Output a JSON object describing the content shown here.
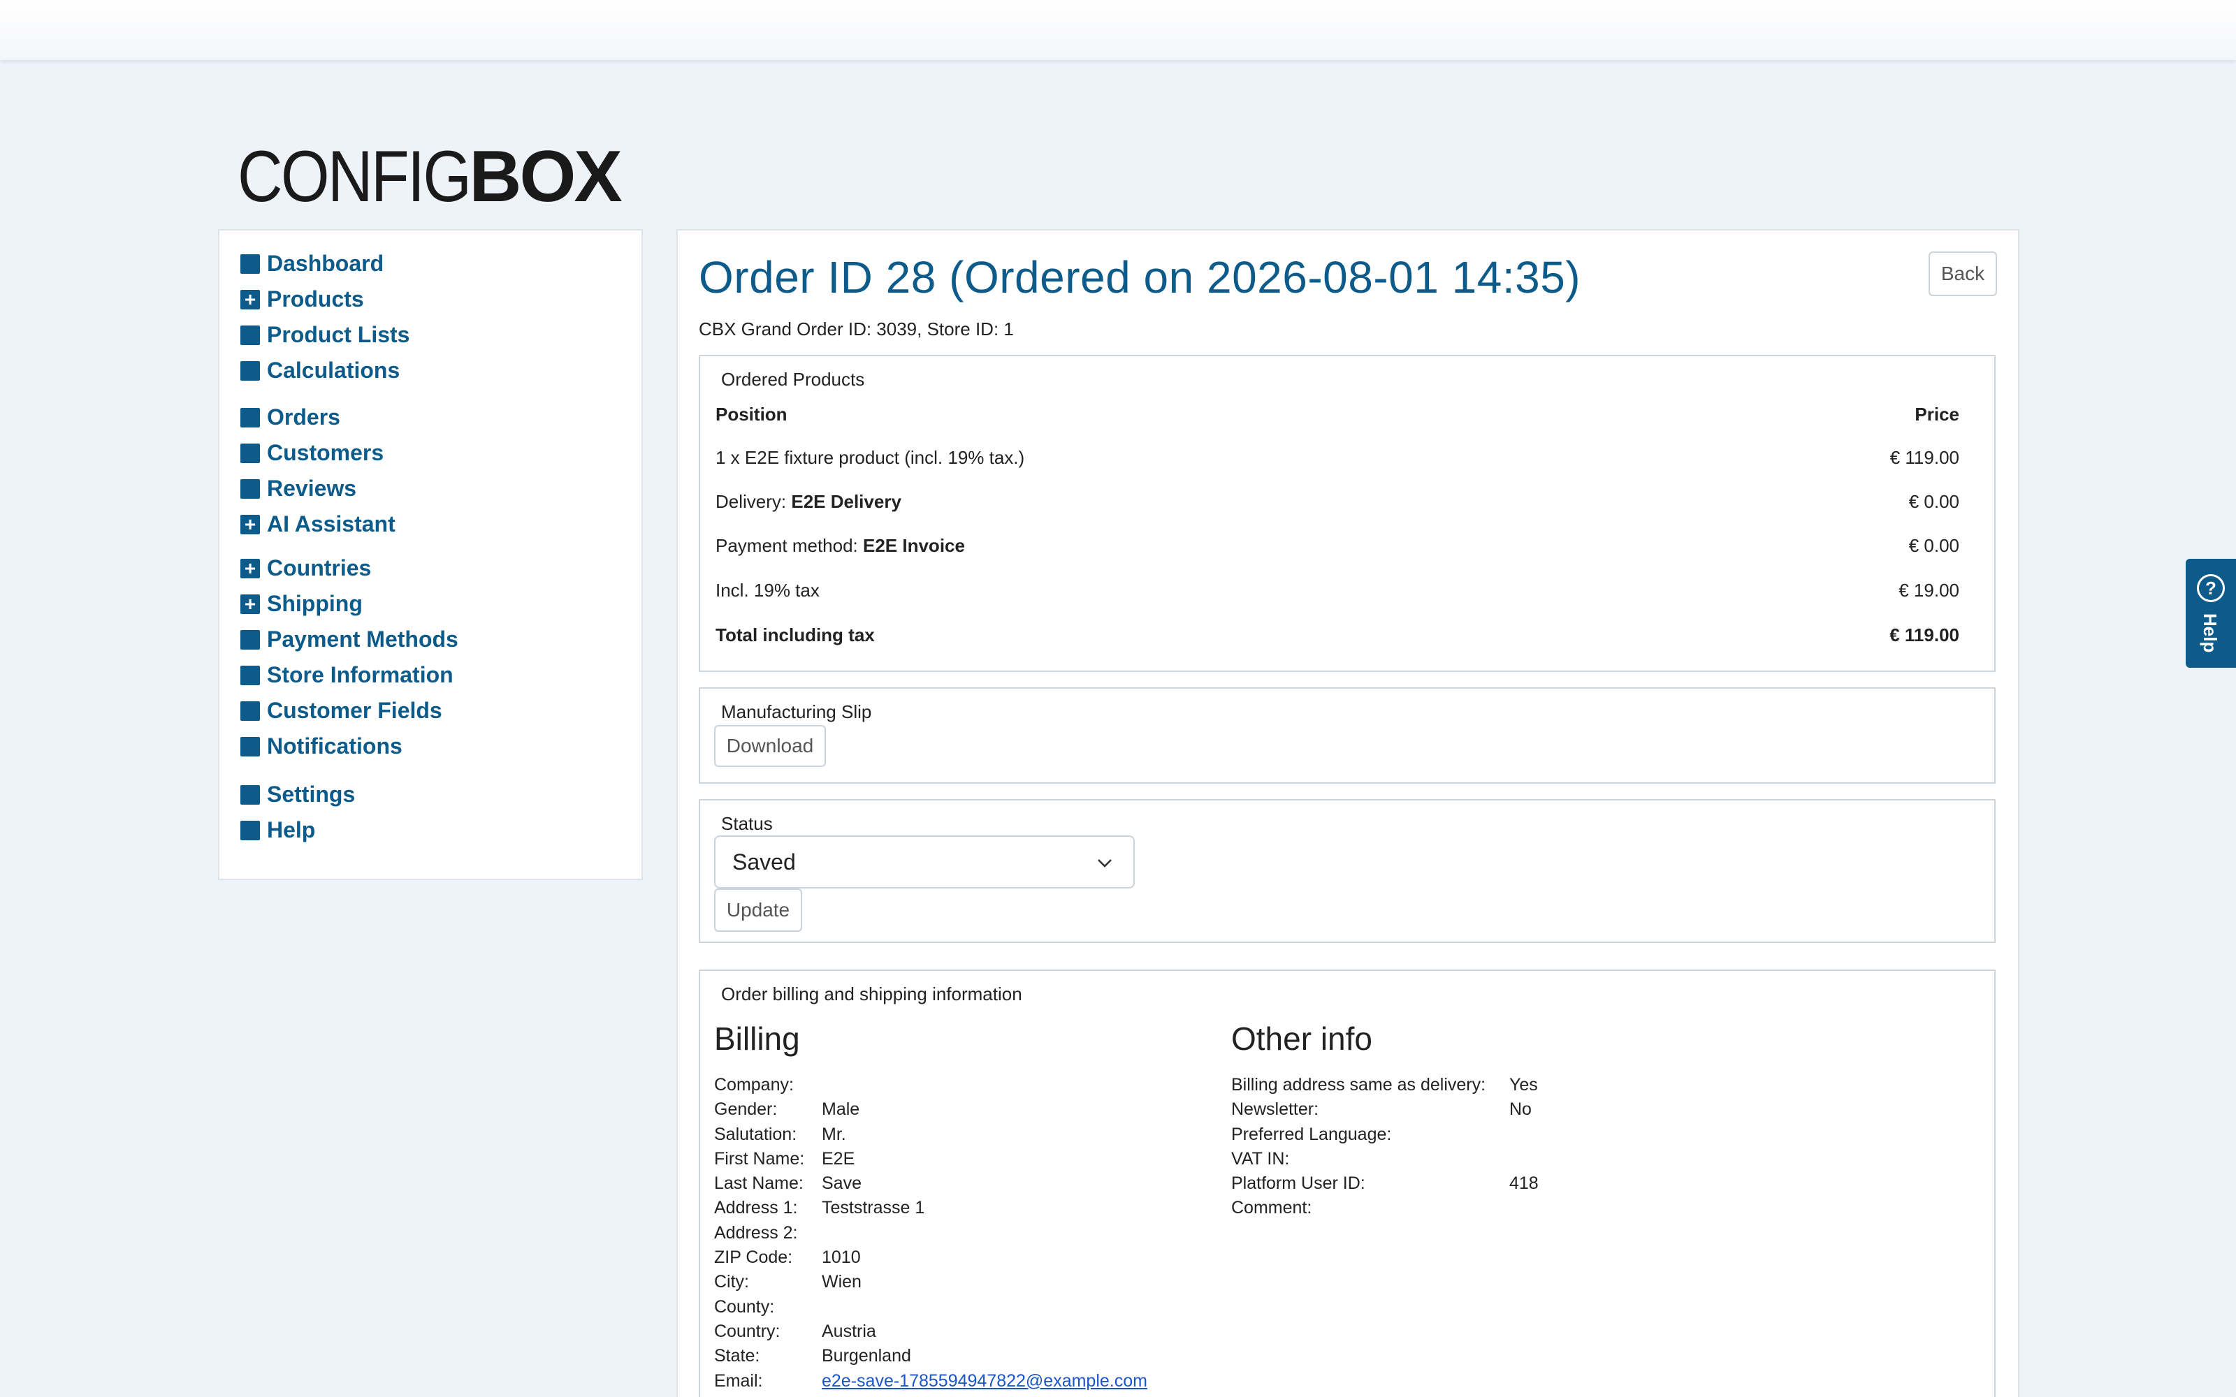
{
  "logo": {
    "light": "CONFIG",
    "bold": "BOX"
  },
  "sidebar": {
    "items": [
      {
        "label": "Dashboard",
        "expandable": false
      },
      {
        "label": "Products",
        "expandable": true
      },
      {
        "label": "Product Lists",
        "expandable": false
      },
      {
        "label": "Calculations",
        "expandable": false
      },
      {
        "label": "Orders",
        "expandable": false
      },
      {
        "label": "Customers",
        "expandable": false
      },
      {
        "label": "Reviews",
        "expandable": false
      },
      {
        "label": "AI Assistant",
        "expandable": true
      },
      {
        "label": "Countries",
        "expandable": true
      },
      {
        "label": "Shipping",
        "expandable": true
      },
      {
        "label": "Payment Methods",
        "expandable": false
      },
      {
        "label": "Store Information",
        "expandable": false
      },
      {
        "label": "Customer Fields",
        "expandable": false
      },
      {
        "label": "Notifications",
        "expandable": false
      },
      {
        "label": "Settings",
        "expandable": false
      },
      {
        "label": "Help",
        "expandable": false
      }
    ]
  },
  "order": {
    "title": "Order ID 28 (Ordered on 2026-08-01 14:35)",
    "back_label": "Back",
    "subline": "CBX Grand Order ID: 3039, Store ID: 1"
  },
  "products": {
    "legend": "Ordered Products",
    "header_position": "Position",
    "header_price": "Price",
    "rows": [
      {
        "prefix": "1 x E2E fixture product (incl. 19% tax.)",
        "bold": "",
        "price": "€ 119.00"
      },
      {
        "prefix": "Delivery: ",
        "bold": "E2E Delivery",
        "price": "€ 0.00"
      },
      {
        "prefix": "Payment method: ",
        "bold": "E2E Invoice",
        "price": "€ 0.00"
      },
      {
        "prefix": "Incl. 19% tax",
        "bold": "",
        "price": "€ 19.00"
      }
    ],
    "total_label": "Total including tax",
    "total_price": "€ 119.00"
  },
  "slip": {
    "legend": "Manufacturing Slip",
    "download_label": "Download"
  },
  "status": {
    "legend": "Status",
    "selected": "Saved",
    "update_label": "Update"
  },
  "info": {
    "legend": "Order billing and shipping information",
    "billing_heading": "Billing",
    "billing": [
      {
        "k": "Company:",
        "v": ""
      },
      {
        "k": "Gender:",
        "v": "Male"
      },
      {
        "k": "Salutation:",
        "v": "Mr."
      },
      {
        "k": "First Name:",
        "v": "E2E"
      },
      {
        "k": "Last Name:",
        "v": "Save"
      },
      {
        "k": "Address 1:",
        "v": "Teststrasse 1"
      },
      {
        "k": "Address 2:",
        "v": ""
      },
      {
        "k": "ZIP Code:",
        "v": "1010"
      },
      {
        "k": "City:",
        "v": "Wien"
      },
      {
        "k": "County:",
        "v": ""
      },
      {
        "k": "Country:",
        "v": "Austria"
      },
      {
        "k": "State:",
        "v": "Burgenland"
      }
    ],
    "email_label": "Email:",
    "email_value": "e2e-save-1785594947822@example.com",
    "other_heading": "Other info",
    "other": [
      {
        "k": "Billing address same as delivery:",
        "v": "Yes"
      },
      {
        "k": "Newsletter:",
        "v": "No"
      },
      {
        "k": "Preferred Language:",
        "v": ""
      },
      {
        "k": "VAT IN:",
        "v": ""
      },
      {
        "k": "Platform User ID:",
        "v": "418"
      },
      {
        "k": "Comment:",
        "v": ""
      }
    ]
  },
  "help_tab": {
    "label": "Help"
  },
  "colors": {
    "accent": "#0d5b8a",
    "background": "#eef3fa"
  }
}
